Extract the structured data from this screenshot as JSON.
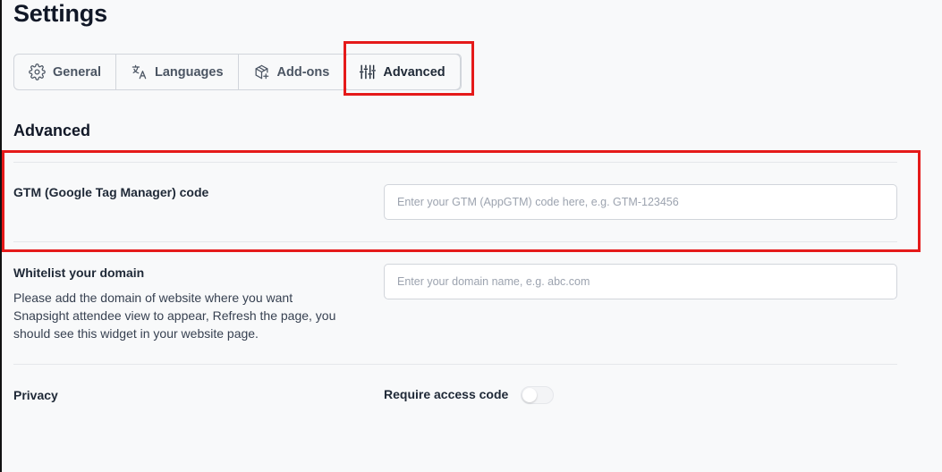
{
  "header": {
    "title": "Settings"
  },
  "tabs": [
    {
      "label": "General",
      "icon": "gear-icon"
    },
    {
      "label": "Languages",
      "icon": "translate-icon"
    },
    {
      "label": "Add-ons",
      "icon": "package-add-icon"
    },
    {
      "label": "Advanced",
      "icon": "sliders-icon",
      "active": true
    }
  ],
  "section": {
    "title": "Advanced"
  },
  "gtm": {
    "label": "GTM (Google Tag Manager) code",
    "placeholder": "Enter your GTM (AppGTM) code here, e.g. GTM-123456",
    "value": ""
  },
  "whitelist": {
    "label": "Whitelist your domain",
    "description": "Please add the domain of website where you want Snapsight attendee view to appear, Refresh the page, you should see this widget in your website page.",
    "placeholder": "Enter your domain name, e.g. abc.com",
    "value": ""
  },
  "privacy": {
    "label": "Privacy",
    "toggle_label": "Require access code",
    "toggle_on": false
  },
  "colors": {
    "highlight": "#e51a1a",
    "border": "#d1d5db",
    "background": "#f8f9fa"
  }
}
